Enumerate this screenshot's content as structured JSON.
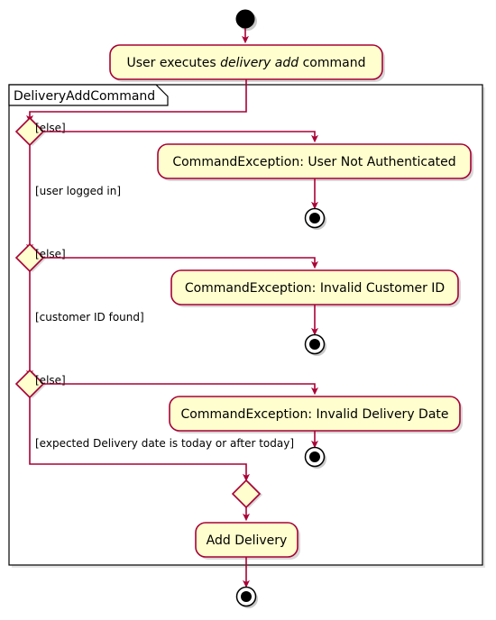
{
  "diagram": {
    "type": "uml-activity-diagram",
    "colors": {
      "node_fill": "#FEFECE",
      "node_border": "#A80036",
      "arrow": "#A80036",
      "partition_border": "#000000",
      "shadow": "#808080",
      "background": "#FFFFFF",
      "text": "#000000"
    },
    "partition": {
      "title": "DeliveryAddCommand"
    },
    "start_node": {
      "name": "start"
    },
    "activities": {
      "user_command": {
        "label_before": "User executes ",
        "label_italic": "delivery add",
        "label_after": " command",
        "label_full": "User executes delivery add command"
      },
      "exception_auth": {
        "label": "CommandException: User Not Authenticated"
      },
      "exception_customer": {
        "label": "CommandException: Invalid Customer ID"
      },
      "exception_date": {
        "label": "CommandException: Invalid Delivery Date"
      },
      "add_delivery": {
        "label": "Add Delivery"
      }
    },
    "decisions": [
      {
        "name": "decision-authentication",
        "else_guard": "[else]",
        "pass_guard": "[user logged in]"
      },
      {
        "name": "decision-customer-id",
        "else_guard": "[else]",
        "pass_guard": "[customer ID found]"
      },
      {
        "name": "decision-delivery-date",
        "else_guard": "[else]",
        "pass_guard": "[expected Delivery date is today or after today]"
      }
    ],
    "merge_node": {
      "name": "merge"
    },
    "end_nodes": [
      {
        "name": "end-authentication-failure"
      },
      {
        "name": "end-customer-id-failure"
      },
      {
        "name": "end-delivery-date-failure"
      },
      {
        "name": "end-success"
      }
    ]
  }
}
